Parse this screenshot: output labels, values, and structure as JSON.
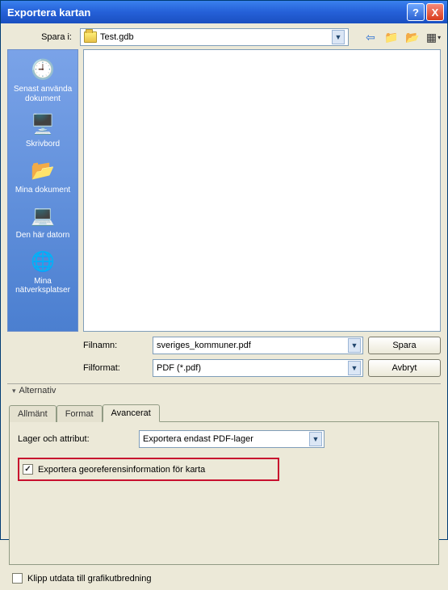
{
  "window": {
    "title": "Exportera kartan",
    "help": "?",
    "close": "X"
  },
  "save_in": {
    "label": "Spara i:",
    "value": "Test.gdb"
  },
  "nav_icons": {
    "back": "⇦",
    "up": "📁",
    "new": "📂",
    "view": "▦",
    "view_arrow": "▾"
  },
  "places": [
    {
      "icon": "🕘",
      "label": "Senast använda\ndokument"
    },
    {
      "icon": "🖥️",
      "label": "Skrivbord"
    },
    {
      "icon": "📂",
      "label": "Mina dokument"
    },
    {
      "icon": "💻",
      "label": "Den här datorn"
    },
    {
      "icon": "🌐",
      "label": "Mina\nnätverksplatser"
    }
  ],
  "filename": {
    "label": "Filnamn:",
    "value": "sveriges_kommuner.pdf"
  },
  "fileformat": {
    "label": "Filformat:",
    "value": "PDF (*.pdf)"
  },
  "buttons": {
    "save": "Spara",
    "cancel": "Avbryt"
  },
  "alternativ": "Alternativ",
  "tabs": {
    "general": "Allmänt",
    "format": "Format",
    "advanced": "Avancerat"
  },
  "advanced": {
    "layers_label": "Lager och attribut:",
    "layers_value": "Exportera endast PDF-lager",
    "georef_checked": true,
    "georef_label": "Exportera georeferensinformation för karta"
  },
  "clip": {
    "label": "Klipp utdata till grafikutbredning"
  }
}
